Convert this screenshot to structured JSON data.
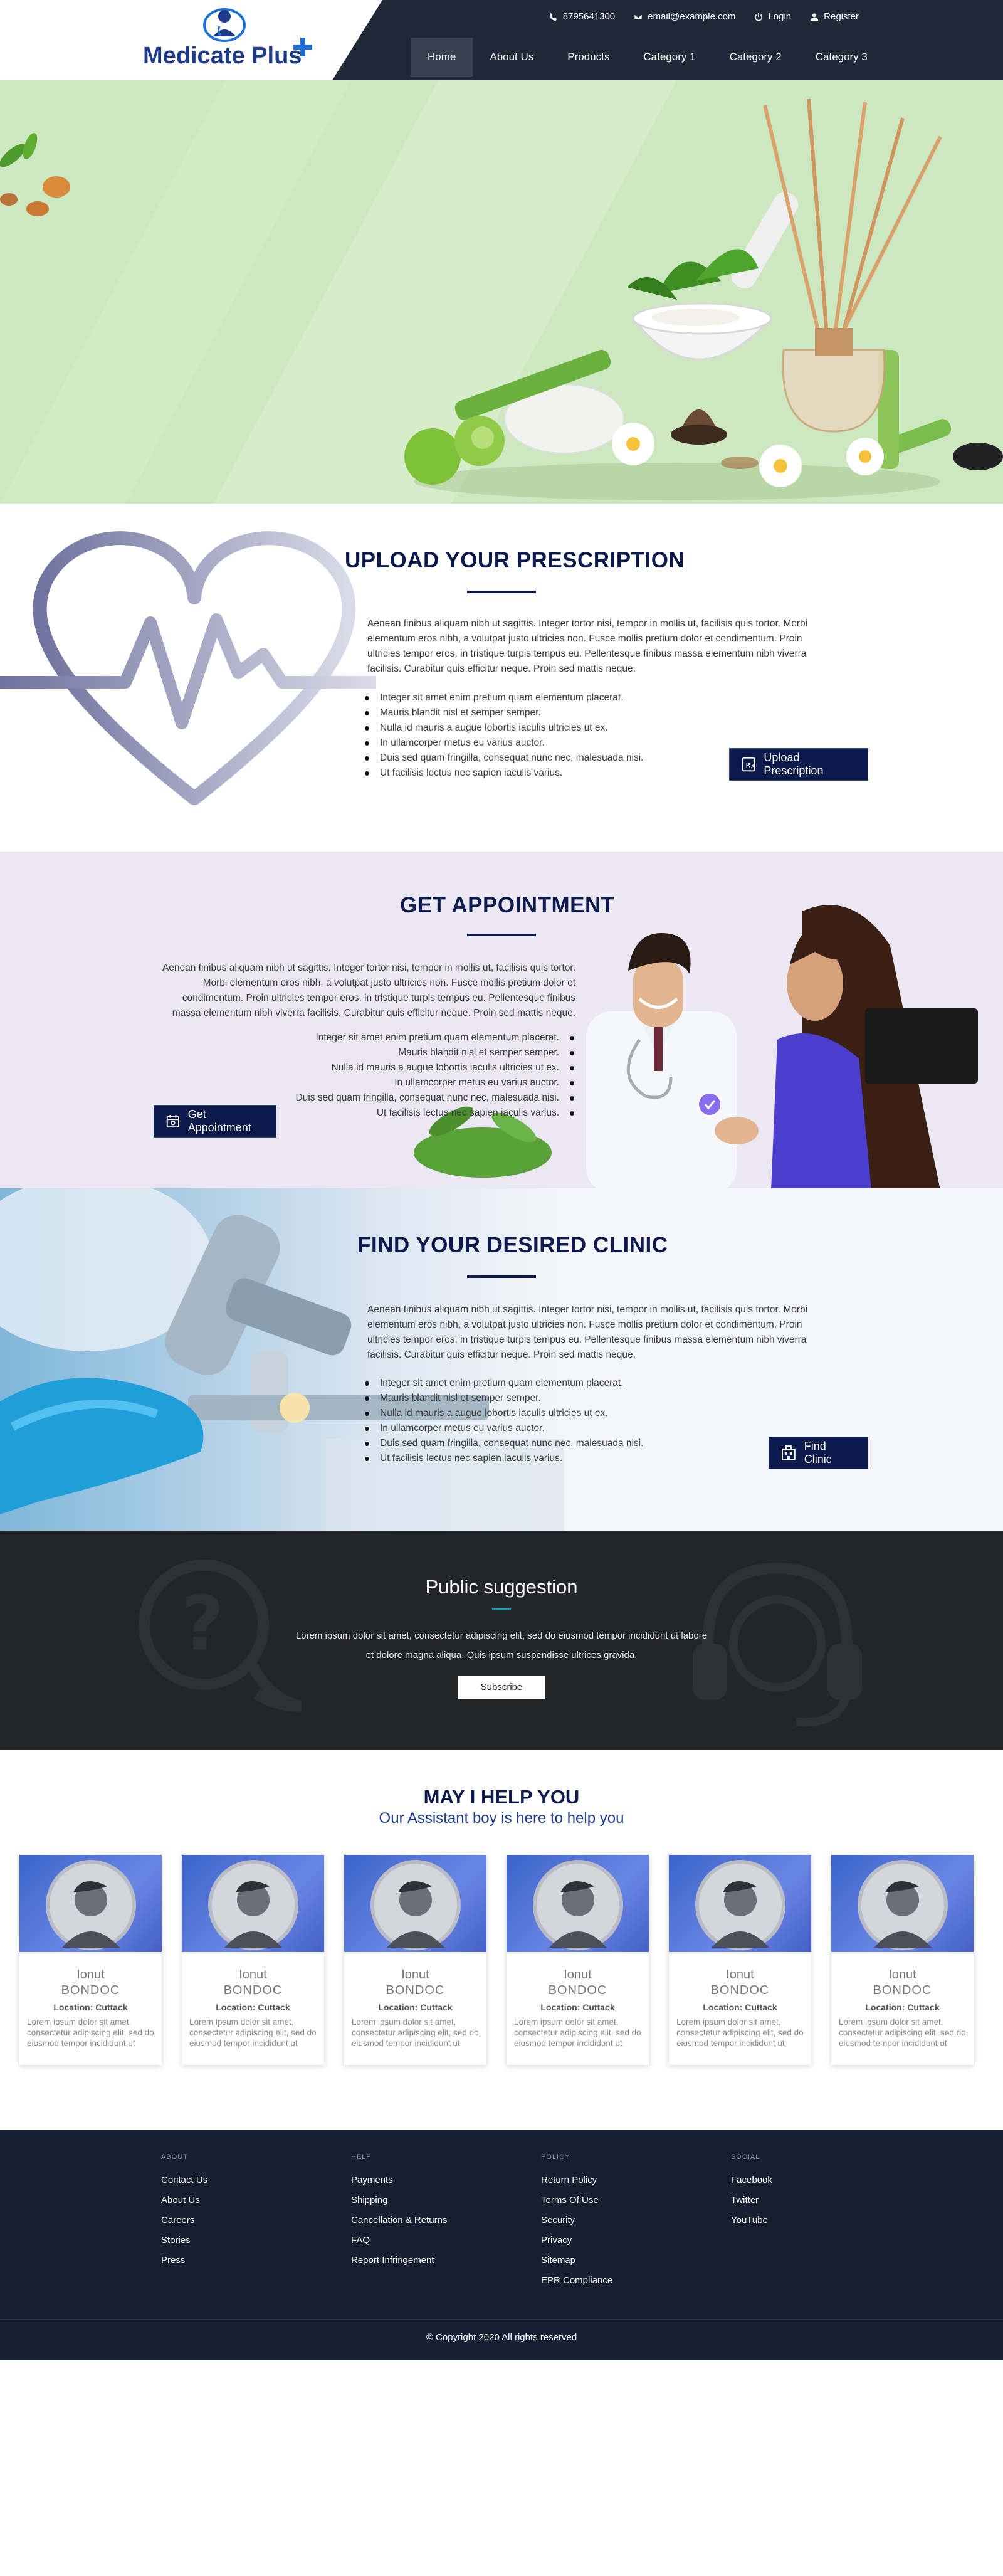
{
  "header": {
    "logo_text": "Medicate Plus",
    "phone": "8795641300",
    "email": "email@example.com",
    "login": "Login",
    "register": "Register",
    "nav": [
      "Home",
      "About Us",
      "Products",
      "Category 1",
      "Category 2",
      "Category 3"
    ],
    "active_nav": "Home"
  },
  "prescription": {
    "title": "UPLOAD YOUR PRESCRIPTION",
    "paragraph": "Aenean finibus aliquam nibh ut sagittis. Integer tortor nisi, tempor in mollis ut, facilisis quis tortor. Morbi elementum eros nibh, a volutpat justo ultricies non. Fusce mollis pretium dolor et condimentum. Proin ultricies tempor eros, in tristique turpis tempus eu. Pellentesque finibus massa elementum nibh viverra facilisis. Curabitur quis efficitur neque. Proin sed mattis neque.",
    "bullets": [
      "Integer sit amet enim pretium quam elementum placerat.",
      "Mauris blandit nisl et semper semper.",
      "Nulla id mauris a augue lobortis iaculis ultricies ut ex.",
      "In ullamcorper metus eu varius auctor.",
      "Duis sed quam fringilla, consequat nunc nec, malesuada nisi.",
      "Ut facilisis lectus nec sapien iaculis varius."
    ],
    "button": "Upload Prescription"
  },
  "appointment": {
    "title": "GET APPOINTMENT",
    "paragraph": "Aenean finibus aliquam nibh ut sagittis. Integer tortor nisi, tempor in mollis ut, facilisis quis tortor. Morbi elementum eros nibh, a volutpat justo ultricies non. Fusce mollis pretium dolor et condimentum. Proin ultricies tempor eros, in tristique turpis tempus eu. Pellentesque finibus massa elementum nibh viverra facilisis. Curabitur quis efficitur neque. Proin sed mattis neque.",
    "bullets": [
      "Integer sit amet enim pretium quam elementum placerat.",
      "Mauris blandit nisl et semper semper.",
      "Nulla id mauris a augue lobortis iaculis ultricies ut ex.",
      "In ullamcorper metus eu varius auctor.",
      "Duis sed quam fringilla, consequat nunc nec, malesuada nisi.",
      "Ut facilisis lectus nec sapien iaculis varius."
    ],
    "button": "Get Appointment"
  },
  "clinic": {
    "title": "FIND YOUR DESIRED CLINIC",
    "paragraph": "Aenean finibus aliquam nibh ut sagittis. Integer tortor nisi, tempor in mollis ut, facilisis quis tortor. Morbi elementum eros nibh, a volutpat justo ultricies non. Fusce mollis pretium dolor et condimentum. Proin ultricies tempor eros, in tristique turpis tempus eu. Pellentesque finibus massa elementum nibh viverra facilisis. Curabitur quis efficitur neque. Proin sed mattis neque.",
    "bullets": [
      "Integer sit amet enim pretium quam elementum placerat.",
      "Mauris blandit nisl et semper semper.",
      "Nulla id mauris a augue lobortis iaculis ultricies ut ex.",
      "In ullamcorper metus eu varius auctor.",
      "Duis sed quam fringilla, consequat nunc nec, malesuada nisi.",
      "Ut facilisis lectus nec sapien iaculis varius."
    ],
    "button": "Find Clinic"
  },
  "suggestion": {
    "title": "Public suggestion",
    "text": "Lorem ipsum dolor sit amet, consectetur adipiscing elit, sed do eiusmod tempor incididunt ut labore et dolore magna aliqua. Quis ipsum suspendisse ultrices gravida.",
    "button": "Subscribe"
  },
  "help": {
    "title": "MAY I HELP YOU",
    "subtitle": "Our Assistant boy is here to help you",
    "cards": [
      {
        "first": "Ionut",
        "last": "BONDOC",
        "location": "Location: Cuttack",
        "desc": "Lorem ipsum dolor sit amet, consectetur adipiscing elit, sed do eiusmod tempor incididunt ut"
      },
      {
        "first": "Ionut",
        "last": "BONDOC",
        "location": "Location: Cuttack",
        "desc": "Lorem ipsum dolor sit amet, consectetur adipiscing elit, sed do eiusmod tempor incididunt ut"
      },
      {
        "first": "Ionut",
        "last": "BONDOC",
        "location": "Location: Cuttack",
        "desc": "Lorem ipsum dolor sit amet, consectetur adipiscing elit, sed do eiusmod tempor incididunt ut"
      },
      {
        "first": "Ionut",
        "last": "BONDOC",
        "location": "Location: Cuttack",
        "desc": "Lorem ipsum dolor sit amet, consectetur adipiscing elit, sed do eiusmod tempor incididunt ut"
      },
      {
        "first": "Ionut",
        "last": "BONDOC",
        "location": "Location: Cuttack",
        "desc": "Lorem ipsum dolor sit amet, consectetur adipiscing elit, sed do eiusmod tempor incididunt ut"
      },
      {
        "first": "Ionut",
        "last": "BONDOC",
        "location": "Location: Cuttack",
        "desc": "Lorem ipsum dolor sit amet, consectetur adipiscing elit, sed do eiusmod tempor incididunt ut"
      }
    ]
  },
  "footer": {
    "columns": [
      {
        "heading": "ABOUT",
        "links": [
          "Contact Us",
          "About Us",
          "Careers",
          "Stories",
          "Press"
        ]
      },
      {
        "heading": "HELP",
        "links": [
          "Payments",
          "Shipping",
          "Cancellation & Returns",
          "FAQ",
          "Report Infringement"
        ]
      },
      {
        "heading": "POLICY",
        "links": [
          "Return Policy",
          "Terms Of Use",
          "Security",
          "Privacy",
          "Sitemap",
          "EPR Compliance"
        ]
      },
      {
        "heading": "SOCIAL",
        "links": [
          "Facebook",
          "Twitter",
          "YouTube"
        ]
      }
    ],
    "copyright": "© Copyright 2020 All rights reserved"
  },
  "colors": {
    "navy": "#0d1b4c",
    "header_bg": "#1f2937",
    "hero_green": "#cde8c0",
    "footer_bg": "#172033",
    "accent_blue": "#1d6fd8"
  }
}
